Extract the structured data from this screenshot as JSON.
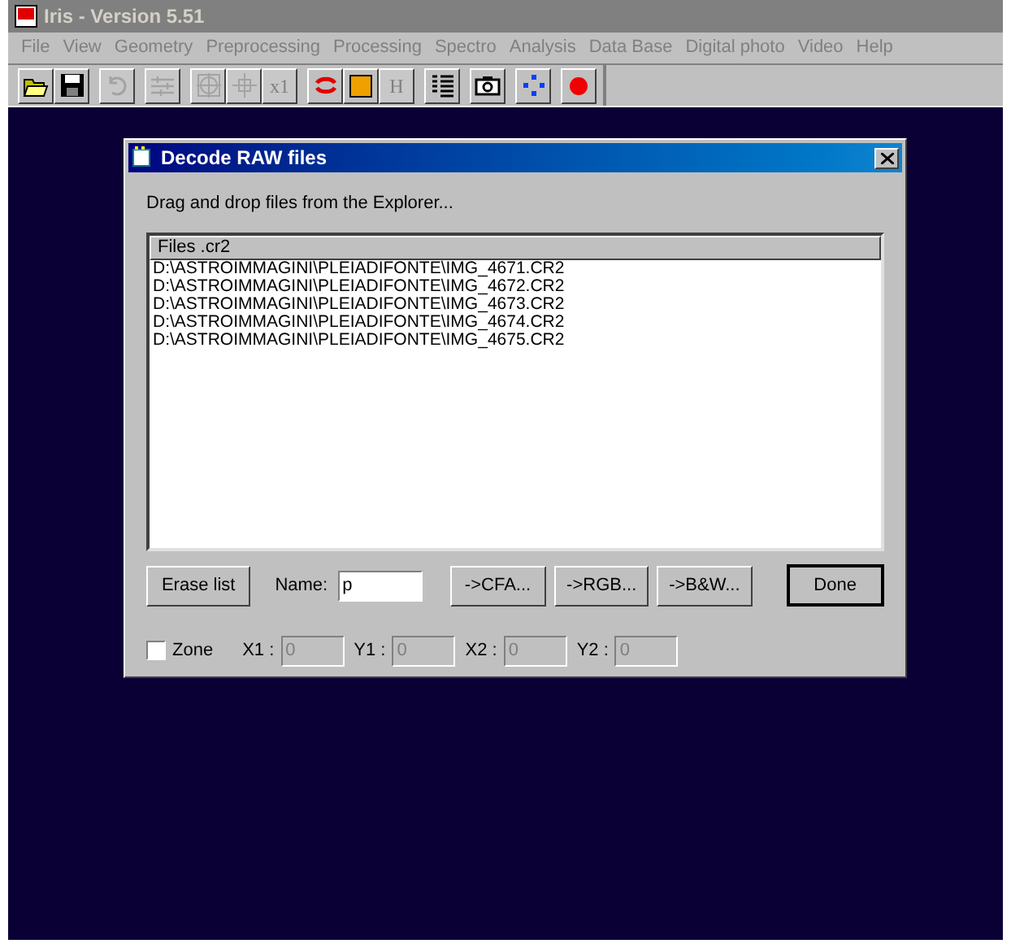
{
  "window": {
    "title": "Iris - Version 5.51"
  },
  "menu": [
    "File",
    "View",
    "Geometry",
    "Preprocessing",
    "Processing",
    "Spectro",
    "Analysis",
    "Data Base",
    "Digital photo",
    "Video",
    "Help"
  ],
  "toolbar": [
    {
      "kind": "open",
      "disabled": false
    },
    {
      "kind": "save",
      "disabled": false
    },
    {
      "kind": "undo",
      "disabled": true
    },
    {
      "kind": "sliders",
      "disabled": true
    },
    {
      "kind": "target",
      "disabled": true
    },
    {
      "kind": "crosshair",
      "disabled": true
    },
    {
      "kind": "text",
      "label": "x1",
      "disabled": true
    },
    {
      "kind": "swirl",
      "disabled": false
    },
    {
      "kind": "square",
      "disabled": false
    },
    {
      "kind": "text",
      "label": "H",
      "disabled": true
    },
    {
      "kind": "list",
      "disabled": false
    },
    {
      "kind": "camera",
      "disabled": false
    },
    {
      "kind": "dots",
      "disabled": false
    },
    {
      "kind": "dot",
      "disabled": false
    }
  ],
  "dialog": {
    "title": "Decode RAW files",
    "hint": "Drag and drop files from the Explorer...",
    "list": {
      "header": "Files .cr2",
      "rows": [
        "D:\\ASTROIMMAGINI\\PLEIADIFONTE\\IMG_4671.CR2",
        "D:\\ASTROIMMAGINI\\PLEIADIFONTE\\IMG_4672.CR2",
        "D:\\ASTROIMMAGINI\\PLEIADIFONTE\\IMG_4673.CR2",
        "D:\\ASTROIMMAGINI\\PLEIADIFONTE\\IMG_4674.CR2",
        "D:\\ASTROIMMAGINI\\PLEIADIFONTE\\IMG_4675.CR2"
      ]
    },
    "erase_button": "Erase list",
    "name_label": "Name:",
    "name_value": "p",
    "convert_buttons": [
      "->CFA...",
      "->RGB...",
      "->B&W..."
    ],
    "done_button": "Done",
    "zone": {
      "label": "Zone",
      "checked": false
    },
    "coords": [
      {
        "label": "X1 :",
        "value": "0",
        "disabled": true
      },
      {
        "label": "Y1 :",
        "value": "0",
        "disabled": true
      },
      {
        "label": "X2 :",
        "value": "0",
        "disabled": true
      },
      {
        "label": "Y2 :",
        "value": "0",
        "disabled": true
      }
    ]
  }
}
